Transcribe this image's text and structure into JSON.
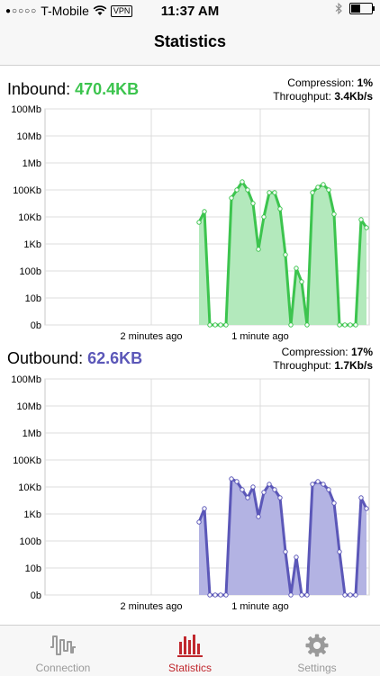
{
  "status_bar": {
    "carrier": "T-Mobile",
    "vpn": "VPN",
    "time": "11:37 AM",
    "battery_level": 0.45
  },
  "nav": {
    "title": "Statistics"
  },
  "inbound": {
    "label": "Inbound:",
    "value": "470.4KB",
    "compression_label": "Compression:",
    "compression_value": "1%",
    "throughput_label": "Throughput:",
    "throughput_value": "3.4Kb/s",
    "color": "#3cc44e",
    "fill": "#b3e9bc"
  },
  "outbound": {
    "label": "Outbound:",
    "value": "62.6KB",
    "compression_label": "Compression:",
    "compression_value": "17%",
    "throughput_label": "Throughput:",
    "throughput_value": "1.7Kb/s",
    "color": "#5b57b8",
    "fill": "#b3b3e3"
  },
  "chart_data": [
    {
      "type": "area",
      "series_name": "Inbound",
      "y_scale": "log",
      "y_ticks": [
        "0b",
        "10b",
        "100b",
        "1Kb",
        "10Kb",
        "100Kb",
        "1Mb",
        "10Mb",
        "100Mb"
      ],
      "x_tick_labels": [
        "2 minutes ago",
        "1 minute ago"
      ],
      "grid": true,
      "y_level_values": [
        3.8,
        4.2,
        0,
        0,
        0,
        0,
        4.7,
        5.0,
        5.3,
        5.0,
        4.5,
        2.8,
        4.0,
        4.9,
        4.9,
        4.3,
        2.6,
        0,
        2.1,
        1.6,
        0,
        4.9,
        5.1,
        5.2,
        5.0,
        4.1,
        0,
        0,
        0,
        0,
        3.9,
        3.6
      ]
    },
    {
      "type": "area",
      "series_name": "Outbound",
      "y_scale": "log",
      "y_ticks": [
        "0b",
        "10b",
        "100b",
        "1Kb",
        "10Kb",
        "100Kb",
        "1Mb",
        "10Mb",
        "100Mb"
      ],
      "x_tick_labels": [
        "2 minutes ago",
        "1 minute ago"
      ],
      "grid": true,
      "y_level_values": [
        2.7,
        3.2,
        0,
        0,
        0,
        0,
        4.3,
        4.2,
        3.9,
        3.6,
        4.0,
        2.9,
        3.8,
        4.1,
        3.9,
        3.6,
        1.6,
        0,
        1.4,
        0,
        0,
        4.1,
        4.2,
        4.1,
        3.9,
        3.4,
        1.6,
        0,
        0,
        0,
        3.6,
        3.2
      ]
    }
  ],
  "tabs": [
    {
      "label": "Connection",
      "icon": "connection-waveform-icon",
      "active": false
    },
    {
      "label": "Statistics",
      "icon": "bar-chart-icon",
      "active": true
    },
    {
      "label": "Settings",
      "icon": "gear-icon",
      "active": false
    }
  ]
}
